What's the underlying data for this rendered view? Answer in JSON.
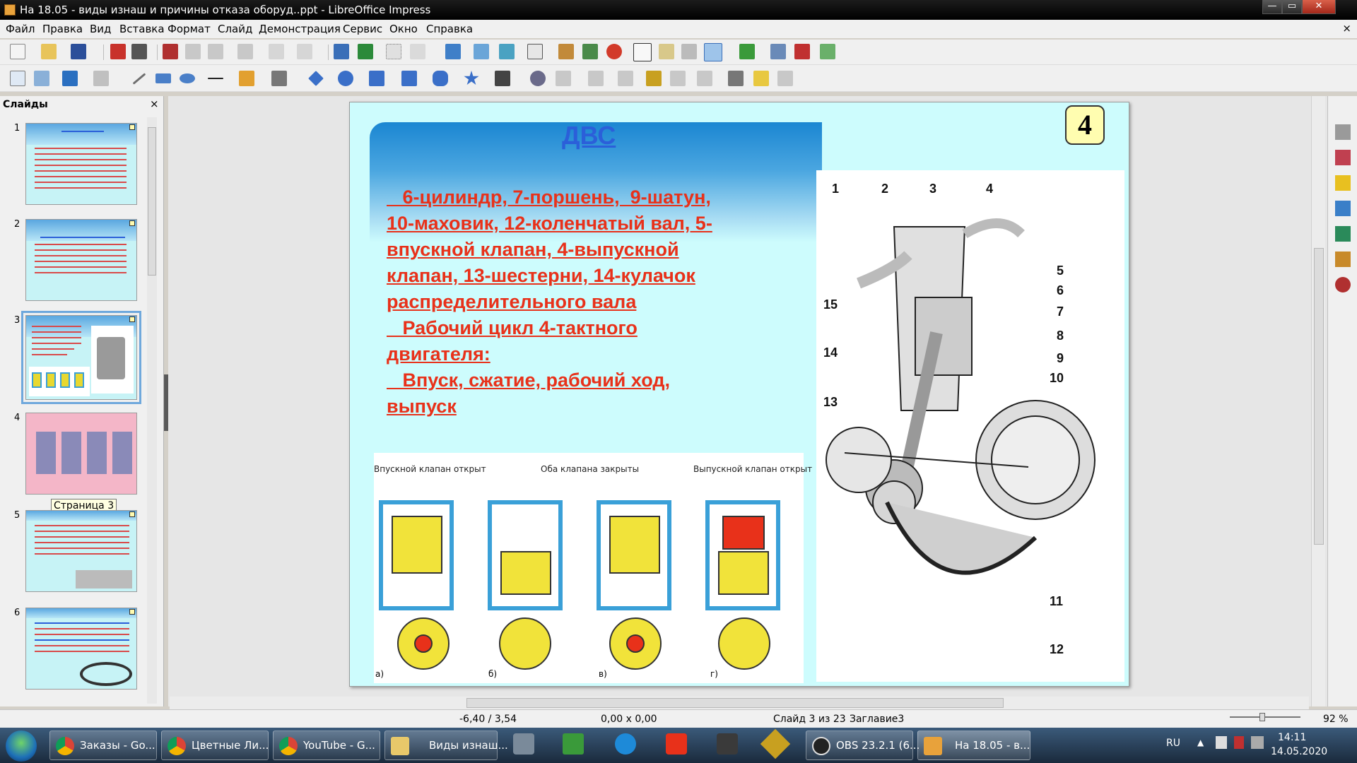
{
  "window": {
    "title": "На 18.05 - виды изнаш и причины отказа оборуд..ppt - LibreOffice Impress",
    "min": "—",
    "max": "▭",
    "close": "✕"
  },
  "menu": [
    "Файл",
    "Правка",
    "Вид",
    "Вставка",
    "Формат",
    "Слайд",
    "Демонстрация",
    "Сервис",
    "Окно",
    "Справка"
  ],
  "menu_close": "×",
  "slides_panel": {
    "title": "Слайды",
    "close": "×",
    "items": [
      {
        "num": "1"
      },
      {
        "num": "2"
      },
      {
        "num": "3"
      },
      {
        "num": "4"
      },
      {
        "num": "5"
      },
      {
        "num": "6"
      }
    ],
    "selected": "3",
    "tooltip": "Страница 3"
  },
  "slide": {
    "title": "ДВС",
    "badge": "4",
    "text_lines": [
      "   6-цилиндр, 7-поршень,  9-шатун,",
      "10-маховик, 12-коленчатый вал, 5-",
      "впускной клапан, 4-выпускной",
      "клапан, 13-шестерни, 14-кулачок",
      "распределительного вала",
      "   Рабочий цикл 4-тактного",
      "двигателя:",
      "   Впуск, сжатие, рабочий ход,",
      "выпуск"
    ],
    "cycle_labels": [
      "Впускной клапан открыт",
      "Оба клапана закрыты",
      "Выпускной клапан открыт"
    ],
    "cycle_letters": [
      "а)",
      "б)",
      "в)",
      "г)"
    ],
    "engine_numbers": [
      "1",
      "2",
      "3",
      "4",
      "5",
      "6",
      "7",
      "8",
      "9",
      "10",
      "11",
      "12",
      "13",
      "14",
      "15"
    ]
  },
  "status": {
    "position": "-6,40 / 3,54",
    "size": "0,00 x 0,00",
    "slide": "Слайд 3 из 23",
    "layout": "Заглавие3",
    "zoom": "92 %"
  },
  "taskbar": {
    "items": [
      {
        "label": "Заказы - Go...",
        "icon": "chrome-icon"
      },
      {
        "label": "Цветные Ли...",
        "icon": "chrome-icon"
      },
      {
        "label": "YouTube - G...",
        "icon": "chrome-icon"
      },
      {
        "label": "Виды изнаш...",
        "icon": "folder-icon"
      },
      {
        "label": "OBS 23.2.1 (6...",
        "icon": "obs-icon"
      },
      {
        "label": "На 18.05 - в...",
        "icon": "impress-icon"
      }
    ],
    "lang": "RU",
    "time": "14:11",
    "date": "14.05.2020"
  },
  "colors": {
    "slide_bg": "#cdfcfd",
    "text_red": "#e8311a",
    "title_blue": "#2b5fd9",
    "badge_bg": "#fffdb0"
  }
}
